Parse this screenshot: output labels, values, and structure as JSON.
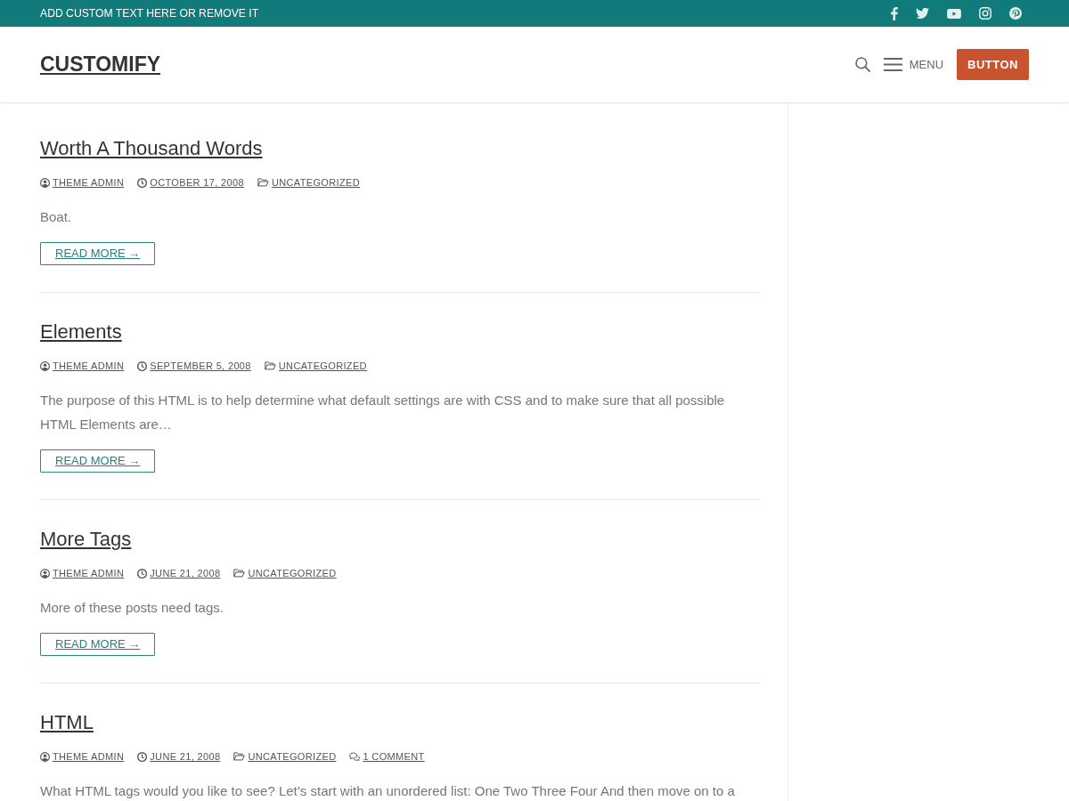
{
  "top_bar": {
    "text": "ADD CUSTOM TEXT HERE OR REMOVE IT",
    "social_links": [
      {
        "kind": "facebook"
      },
      {
        "kind": "twitter"
      },
      {
        "kind": "youtube"
      },
      {
        "kind": "instagram"
      },
      {
        "kind": "pinterest"
      }
    ]
  },
  "header": {
    "logo": "CUSTOMIFY",
    "menu_label": "MENU",
    "button": "BUTTON"
  },
  "posts": [
    {
      "title": "Worth A Thousand Words",
      "meta": [
        {
          "kind": "author",
          "text": "THEME ADMIN"
        },
        {
          "kind": "date",
          "text": "OCTOBER 17, 2008"
        },
        {
          "kind": "category",
          "text": "UNCATEGORIZED"
        }
      ],
      "excerpt": "Boat.",
      "read_more": "READ MORE →"
    },
    {
      "title": "Elements",
      "meta": [
        {
          "kind": "author",
          "text": "THEME ADMIN"
        },
        {
          "kind": "date",
          "text": "SEPTEMBER 5, 2008"
        },
        {
          "kind": "category",
          "text": "UNCATEGORIZED"
        }
      ],
      "excerpt": "The purpose of this HTML is to help determine what default settings are with CSS and to make sure that all possible HTML Elements are…",
      "read_more": "READ MORE →"
    },
    {
      "title": "More Tags",
      "meta": [
        {
          "kind": "author",
          "text": "THEME ADMIN"
        },
        {
          "kind": "date",
          "text": "JUNE 21, 2008"
        },
        {
          "kind": "category",
          "text": "UNCATEGORIZED"
        }
      ],
      "excerpt": "More of these posts need tags.",
      "read_more": "READ MORE →"
    },
    {
      "title": "HTML",
      "meta": [
        {
          "kind": "author",
          "text": "THEME ADMIN"
        },
        {
          "kind": "date",
          "text": "JUNE 21, 2008"
        },
        {
          "kind": "category",
          "text": "UNCATEGORIZED"
        },
        {
          "kind": "comments",
          "text": "1 COMMENT"
        }
      ],
      "excerpt": "What HTML tags would you like to see? Let’s start with an unordered list: One Two Three Four And then move on to a"
    }
  ]
}
